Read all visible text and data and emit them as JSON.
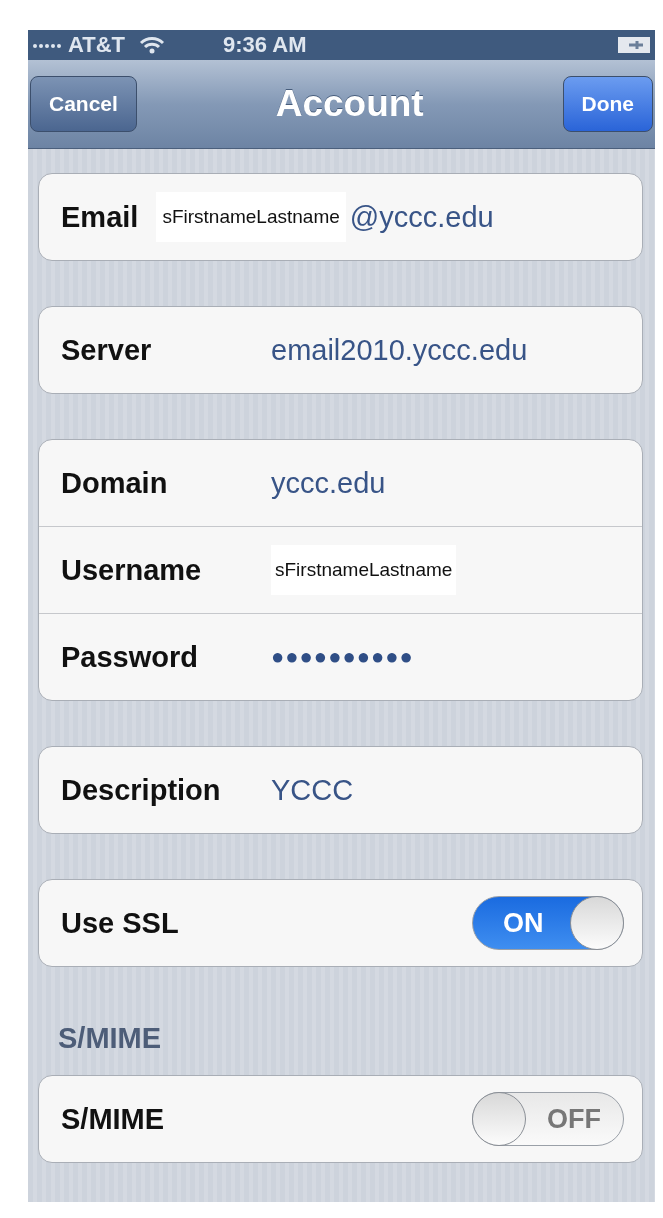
{
  "status_bar": {
    "carrier": "AT&T",
    "time": "9:36 AM"
  },
  "nav": {
    "title": "Account",
    "left_button": "Cancel",
    "right_button": "Done"
  },
  "groups": [
    {
      "rows": [
        {
          "kind": "text",
          "label": "Email",
          "prefix": "sFirstnameLastname",
          "value": "@yccc.edu"
        }
      ]
    },
    {
      "rows": [
        {
          "kind": "text",
          "label": "Server",
          "value": "email2010.yccc.edu"
        }
      ]
    },
    {
      "rows": [
        {
          "kind": "text",
          "label": "Domain",
          "value": "yccc.edu"
        },
        {
          "kind": "pasted",
          "label": "Username",
          "value": "sFirstnameLastname"
        },
        {
          "kind": "password",
          "label": "Password",
          "value": "●●●●●●●●●●"
        }
      ]
    },
    {
      "rows": [
        {
          "kind": "text",
          "label": "Description",
          "value": "YCCC"
        }
      ]
    },
    {
      "rows": [
        {
          "kind": "toggle",
          "label": "Use SSL",
          "on": true,
          "toggle_label": "ON"
        }
      ]
    },
    {
      "header": "S/MIME",
      "rows": [
        {
          "kind": "toggle",
          "label": "S/MIME",
          "on": false,
          "toggle_label": "OFF"
        }
      ]
    }
  ]
}
